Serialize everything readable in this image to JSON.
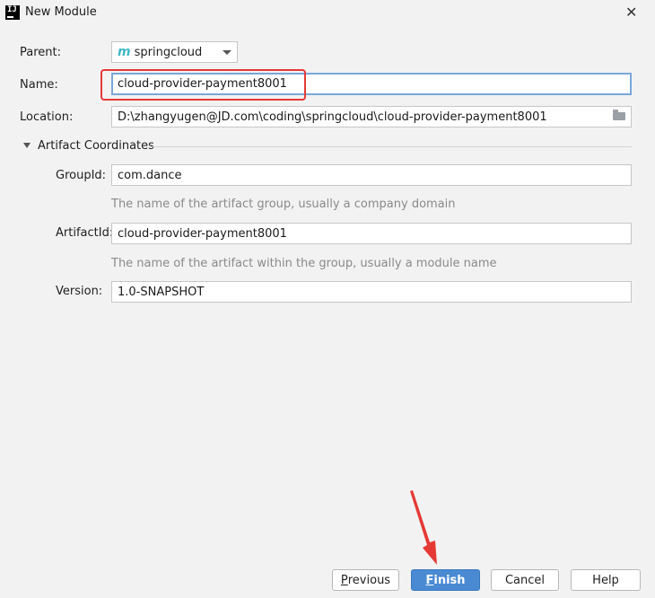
{
  "window": {
    "title": "New Module",
    "app_icon_text": "IJ",
    "close_glyph": "✕"
  },
  "form": {
    "parent": {
      "label": "Parent:",
      "value": "springcloud",
      "icon": "maven-m-icon",
      "icon_glyph": "m"
    },
    "name": {
      "label": "Name:",
      "value": "cloud-provider-payment8001"
    },
    "location": {
      "label": "Location:",
      "value": "D:\\zhangyugen@JD.com\\coding\\springcloud\\cloud-provider-payment8001",
      "icon": "folder-icon"
    }
  },
  "artifact_section": {
    "title": "Artifact Coordinates",
    "expanded": true,
    "group_id": {
      "label": "GroupId:",
      "value": "com.dance",
      "hint": "The name of the artifact group, usually a company domain"
    },
    "artifact_id": {
      "label": "ArtifactId:",
      "value": "cloud-provider-payment8001",
      "hint": "The name of the artifact within the group, usually a module name"
    },
    "version": {
      "label": "Version:",
      "value": "1.0-SNAPSHOT"
    }
  },
  "buttons": {
    "previous": {
      "mnemonic": "P",
      "rest": "revious"
    },
    "finish": {
      "mnemonic": "F",
      "rest": "inish"
    },
    "cancel": "Cancel",
    "help": "Help"
  },
  "colors": {
    "dialog_bg": "#f2f2f2",
    "primary_button": "#4a8ad3",
    "annotation_red": "#e53935",
    "focus_border": "#7aa7d9"
  }
}
